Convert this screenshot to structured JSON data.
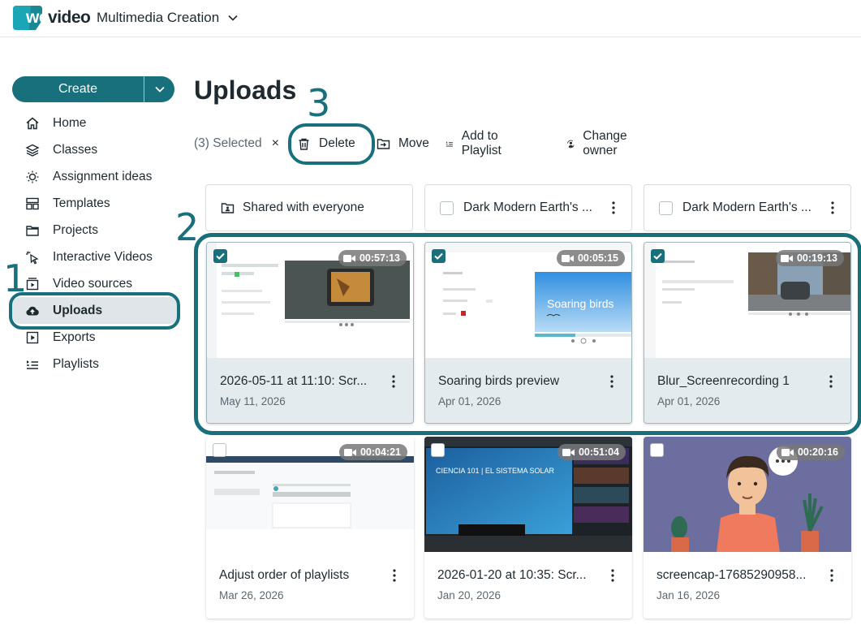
{
  "app": {
    "logo": "wevideo",
    "logo_prefix": "we",
    "logo_suffix": "video",
    "workspace": "Multimedia Creation"
  },
  "sidebar": {
    "create_label": "Create",
    "items": [
      {
        "label": "Home",
        "icon": "home-icon"
      },
      {
        "label": "Classes",
        "icon": "layers-icon"
      },
      {
        "label": "Assignment ideas",
        "icon": "bulb-icon"
      },
      {
        "label": "Templates",
        "icon": "templates-icon"
      },
      {
        "label": "Projects",
        "icon": "folder-icon"
      },
      {
        "label": "Interactive Videos",
        "icon": "pointer-icon"
      },
      {
        "label": "Video sources",
        "icon": "video-source-icon"
      },
      {
        "label": "Uploads",
        "icon": "cloud-upload-icon",
        "active": true
      },
      {
        "label": "Exports",
        "icon": "play-square-icon"
      },
      {
        "label": "Playlists",
        "icon": "playlist-icon"
      }
    ]
  },
  "callouts": {
    "one": "1",
    "two": "2",
    "three": "3"
  },
  "main": {
    "title": "Uploads",
    "toolbar": {
      "selected": "(3) Selected",
      "clear": "×",
      "delete": "Delete",
      "move": "Move",
      "add_to_playlist": "Add to Playlist",
      "change_owner": "Change owner"
    },
    "folders": [
      {
        "name": "Shared with everyone",
        "type": "shared"
      },
      {
        "name": "Dark Modern Earth's ...",
        "type": "item"
      },
      {
        "name": "Dark Modern Earth's ...",
        "type": "item"
      }
    ],
    "cards": [
      {
        "title": "2026-05-11 at 11:10: Scr...",
        "date": "May 11, 2026",
        "duration": "00:57:13",
        "selected": true
      },
      {
        "title": "Soaring birds preview",
        "date": "Apr 01, 2026",
        "duration": "00:05:15",
        "selected": true,
        "overlay_text": "Soaring birds"
      },
      {
        "title": "Blur_Screenrecording 1",
        "date": "Apr 01, 2026",
        "duration": "00:19:13",
        "selected": true
      },
      {
        "title": "Adjust order of playlists",
        "date": "Mar 26, 2026",
        "duration": "00:04:21",
        "selected": false
      },
      {
        "title": "2026-01-20 at 10:35: Scr...",
        "date": "Jan 20, 2026",
        "duration": "00:51:04",
        "selected": false,
        "overlay_text": "CIENCIA 101 | EL SISTEMA SOLAR"
      },
      {
        "title": "screencap-17685290958...",
        "date": "Jan 16, 2026",
        "duration": "00:20:16",
        "selected": false
      }
    ]
  },
  "colors": {
    "accent": "#17707c",
    "selected_meta_bg": "#e3ebee",
    "active_nav_bg": "#dfe5e8"
  }
}
